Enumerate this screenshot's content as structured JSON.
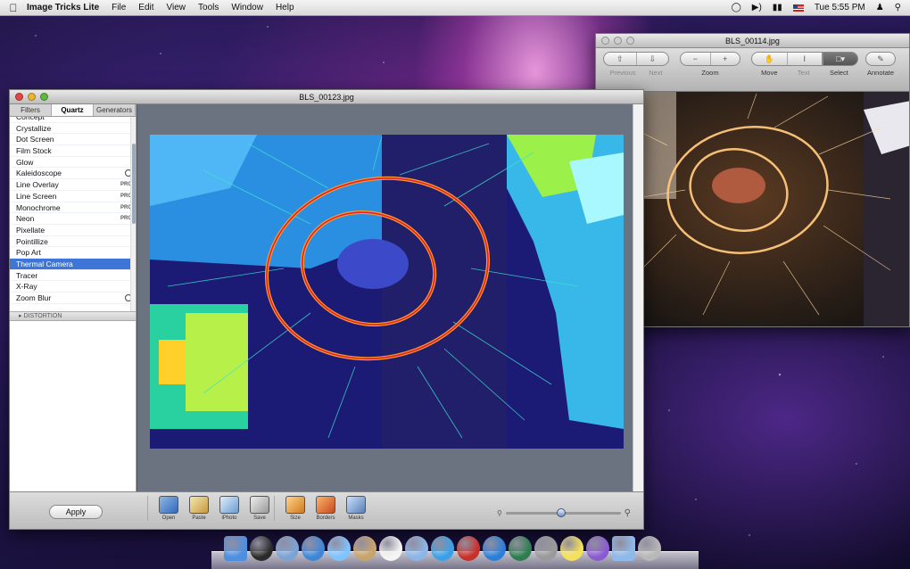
{
  "menubar": {
    "app_name": "Image Tricks Lite",
    "menus": [
      "File",
      "Edit",
      "View",
      "Tools",
      "Window",
      "Help"
    ],
    "clock": "Tue 5:55 PM"
  },
  "main_window": {
    "title": "BLS_00123.jpg",
    "tabs": [
      "Filters",
      "Quartz",
      "Generators"
    ],
    "active_tab": "Quartz",
    "filters": [
      {
        "label": "Concept",
        "badge": ""
      },
      {
        "label": "Crystallize",
        "badge": ""
      },
      {
        "label": "Dot Screen",
        "badge": ""
      },
      {
        "label": "Film Stock",
        "badge": ""
      },
      {
        "label": "Glow",
        "badge": ""
      },
      {
        "label": "Kaleidoscope",
        "badge": "circle"
      },
      {
        "label": "Line Overlay",
        "badge": "PRO"
      },
      {
        "label": "Line Screen",
        "badge": "PRO"
      },
      {
        "label": "Monochrome",
        "badge": "PRO"
      },
      {
        "label": "Neon",
        "badge": "PRO"
      },
      {
        "label": "Pixellate",
        "badge": ""
      },
      {
        "label": "Pointillize",
        "badge": ""
      },
      {
        "label": "Pop Art",
        "badge": ""
      },
      {
        "label": "Thermal Camera",
        "badge": ""
      },
      {
        "label": "Tracer",
        "badge": ""
      },
      {
        "label": "X-Ray",
        "badge": ""
      },
      {
        "label": "Zoom Blur",
        "badge": "circle"
      }
    ],
    "selected_filter": "Thermal Camera",
    "category": "DISTORTION",
    "apply_label": "Apply",
    "tools": [
      {
        "label": "Open",
        "icon": "folder-icon"
      },
      {
        "label": "Paste",
        "icon": "paste-icon"
      },
      {
        "label": "iPhoto",
        "icon": "iphoto-icon"
      },
      {
        "label": "Save",
        "icon": "save-icon"
      }
    ],
    "tools2": [
      {
        "label": "Size",
        "icon": "size-icon"
      },
      {
        "label": "Borders",
        "icon": "borders-icon"
      },
      {
        "label": "Masks",
        "icon": "masks-icon"
      }
    ],
    "zoom_level": 0.44
  },
  "preview_window": {
    "title": "BLS_00114.jpg",
    "tools": [
      {
        "label": "Previous",
        "disabled": true
      },
      {
        "label": "Next",
        "disabled": true
      },
      {
        "label": "Zoom"
      },
      {
        "label": "Move"
      },
      {
        "label": "Text"
      },
      {
        "label": "Select"
      },
      {
        "label": "Annotate"
      }
    ]
  },
  "dock": {
    "icons": [
      "finder-icon",
      "dashboard-icon",
      "photo-icon",
      "safari-icon",
      "chat-icon",
      "preview-icon",
      "calendar-icon",
      "iphoto-icon",
      "itunes-icon",
      "book-icon",
      "appstore-icon",
      "timemachine-icon",
      "systemprefs-icon",
      "stickies-icon",
      "imagetricks-icon",
      "folder-icon",
      "trash-icon"
    ]
  },
  "colors": {
    "selection": "#3d76d6",
    "thermal_bg": "#1b1a74",
    "sparkle": "#ffb347"
  }
}
